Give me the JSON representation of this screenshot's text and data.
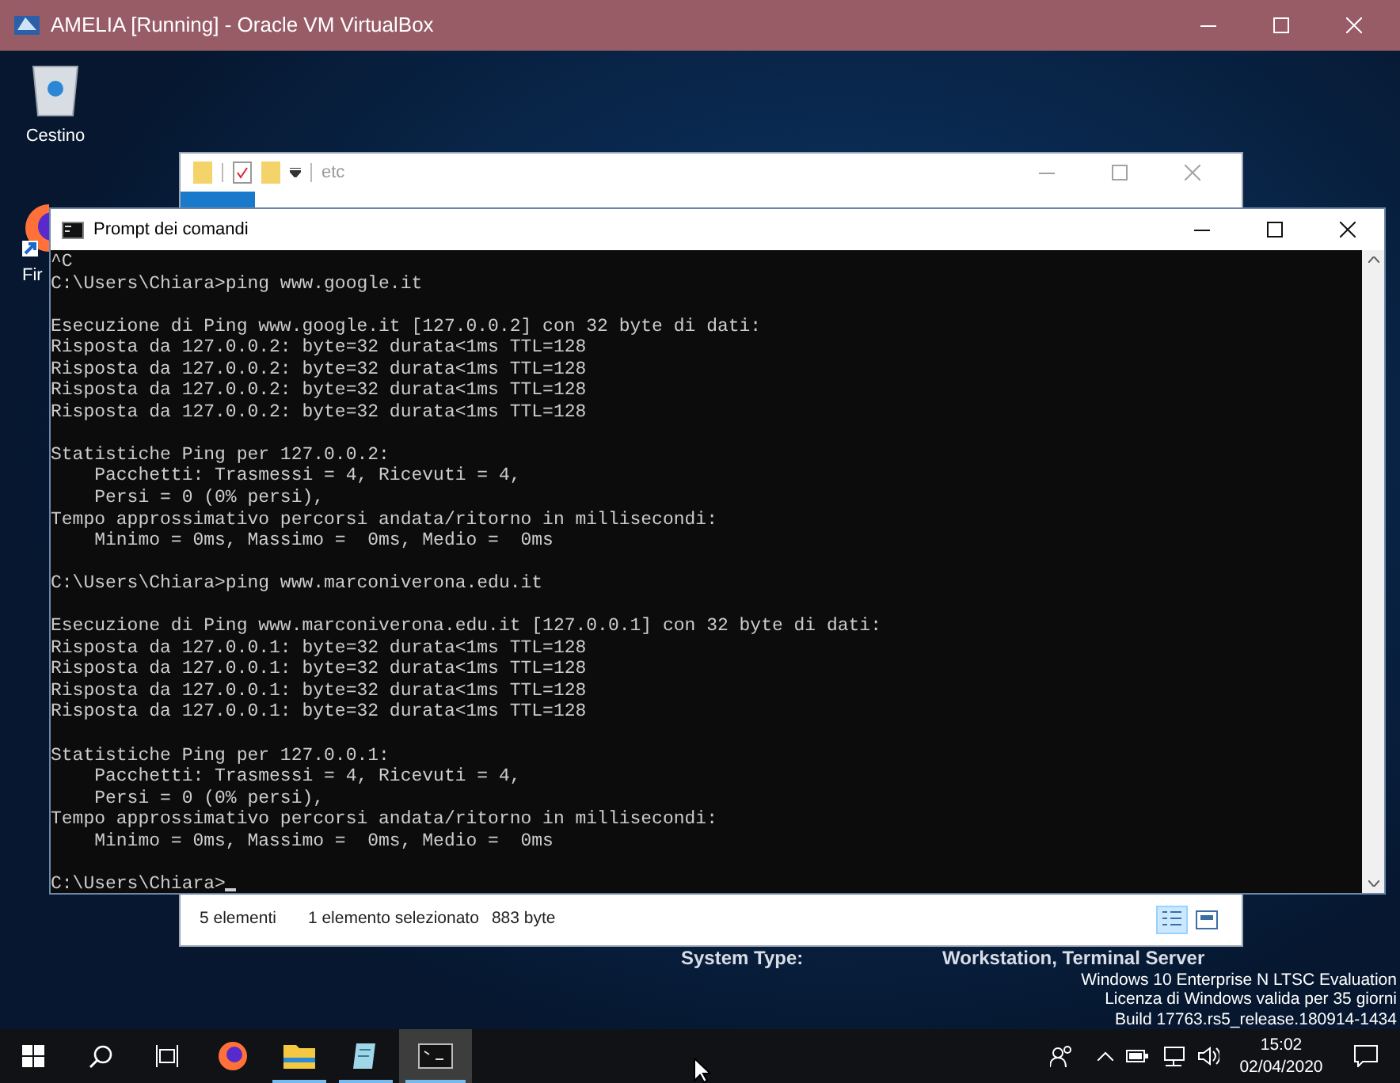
{
  "vm_window": {
    "title": "AMELIA [Running] - Oracle VM VirtualBox"
  },
  "desktop": {
    "icons": [
      {
        "kind": "bin",
        "label": "Cestino"
      },
      {
        "kind": "browser",
        "label": "Fir"
      }
    ],
    "system_info": [
      {
        "label": "System Type:",
        "value": "Workstation, Terminal Server"
      }
    ],
    "watermark": [
      "Windows 10 Enterprise N LTSC Evaluation",
      "Licenza di Windows valida per 35 giorni",
      "Build 17763.rs5_release.180914-1434"
    ]
  },
  "explorer": {
    "path": "etc",
    "status": {
      "items": "5 elementi",
      "selection": "1 elemento selezionato",
      "size": "883 byte"
    },
    "views": [
      {
        "kind": "details",
        "selected": true
      },
      {
        "kind": "tiles",
        "selected": false
      }
    ]
  },
  "cmd": {
    "title": "Prompt dei comandi",
    "blocks": [
      [
        "^C",
        "C:\\Users\\Chiara>ping www.google.it"
      ],
      [
        "Esecuzione di Ping www.google.it [127.0.0.2] con 32 byte di dati:",
        "Risposta da 127.0.0.2: byte=32 durata<1ms TTL=128",
        "Risposta da 127.0.0.2: byte=32 durata<1ms TTL=128",
        "Risposta da 127.0.0.2: byte=32 durata<1ms TTL=128",
        "Risposta da 127.0.0.2: byte=32 durata<1ms TTL=128"
      ],
      [
        "Statistiche Ping per 127.0.0.2:",
        "    Pacchetti: Trasmessi = 4, Ricevuti = 4,",
        "    Persi = 0 (0% persi),",
        "Tempo approssimativo percorsi andata/ritorno in millisecondi:",
        "    Minimo = 0ms, Massimo =  0ms, Medio =  0ms"
      ],
      [
        "C:\\Users\\Chiara>ping www.marconiverona.edu.it"
      ],
      [
        "Esecuzione di Ping www.marconiverona.edu.it [127.0.0.1] con 32 byte di dati:",
        "Risposta da 127.0.0.1: byte=32 durata<1ms TTL=128",
        "Risposta da 127.0.0.1: byte=32 durata<1ms TTL=128",
        "Risposta da 127.0.0.1: byte=32 durata<1ms TTL=128",
        "Risposta da 127.0.0.1: byte=32 durata<1ms TTL=128"
      ],
      [
        "Statistiche Ping per 127.0.0.1:",
        "    Pacchetti: Trasmessi = 4, Ricevuti = 4,",
        "    Persi = 0 (0% persi),",
        "Tempo approssimativo percorsi andata/ritorno in millisecondi:",
        "    Minimo = 0ms, Massimo =  0ms, Medio =  0ms"
      ],
      [
        "C:\\Users\\Chiara>"
      ]
    ]
  },
  "taskbar": {
    "apps": [
      {
        "kind": "firefox",
        "running": false,
        "selected": false
      },
      {
        "kind": "explorer",
        "running": true,
        "selected": false
      },
      {
        "kind": "notepad",
        "running": true,
        "selected": false
      },
      {
        "kind": "cmd",
        "running": true,
        "selected": true
      }
    ],
    "time": "15:02",
    "date": "02/04/2020"
  }
}
